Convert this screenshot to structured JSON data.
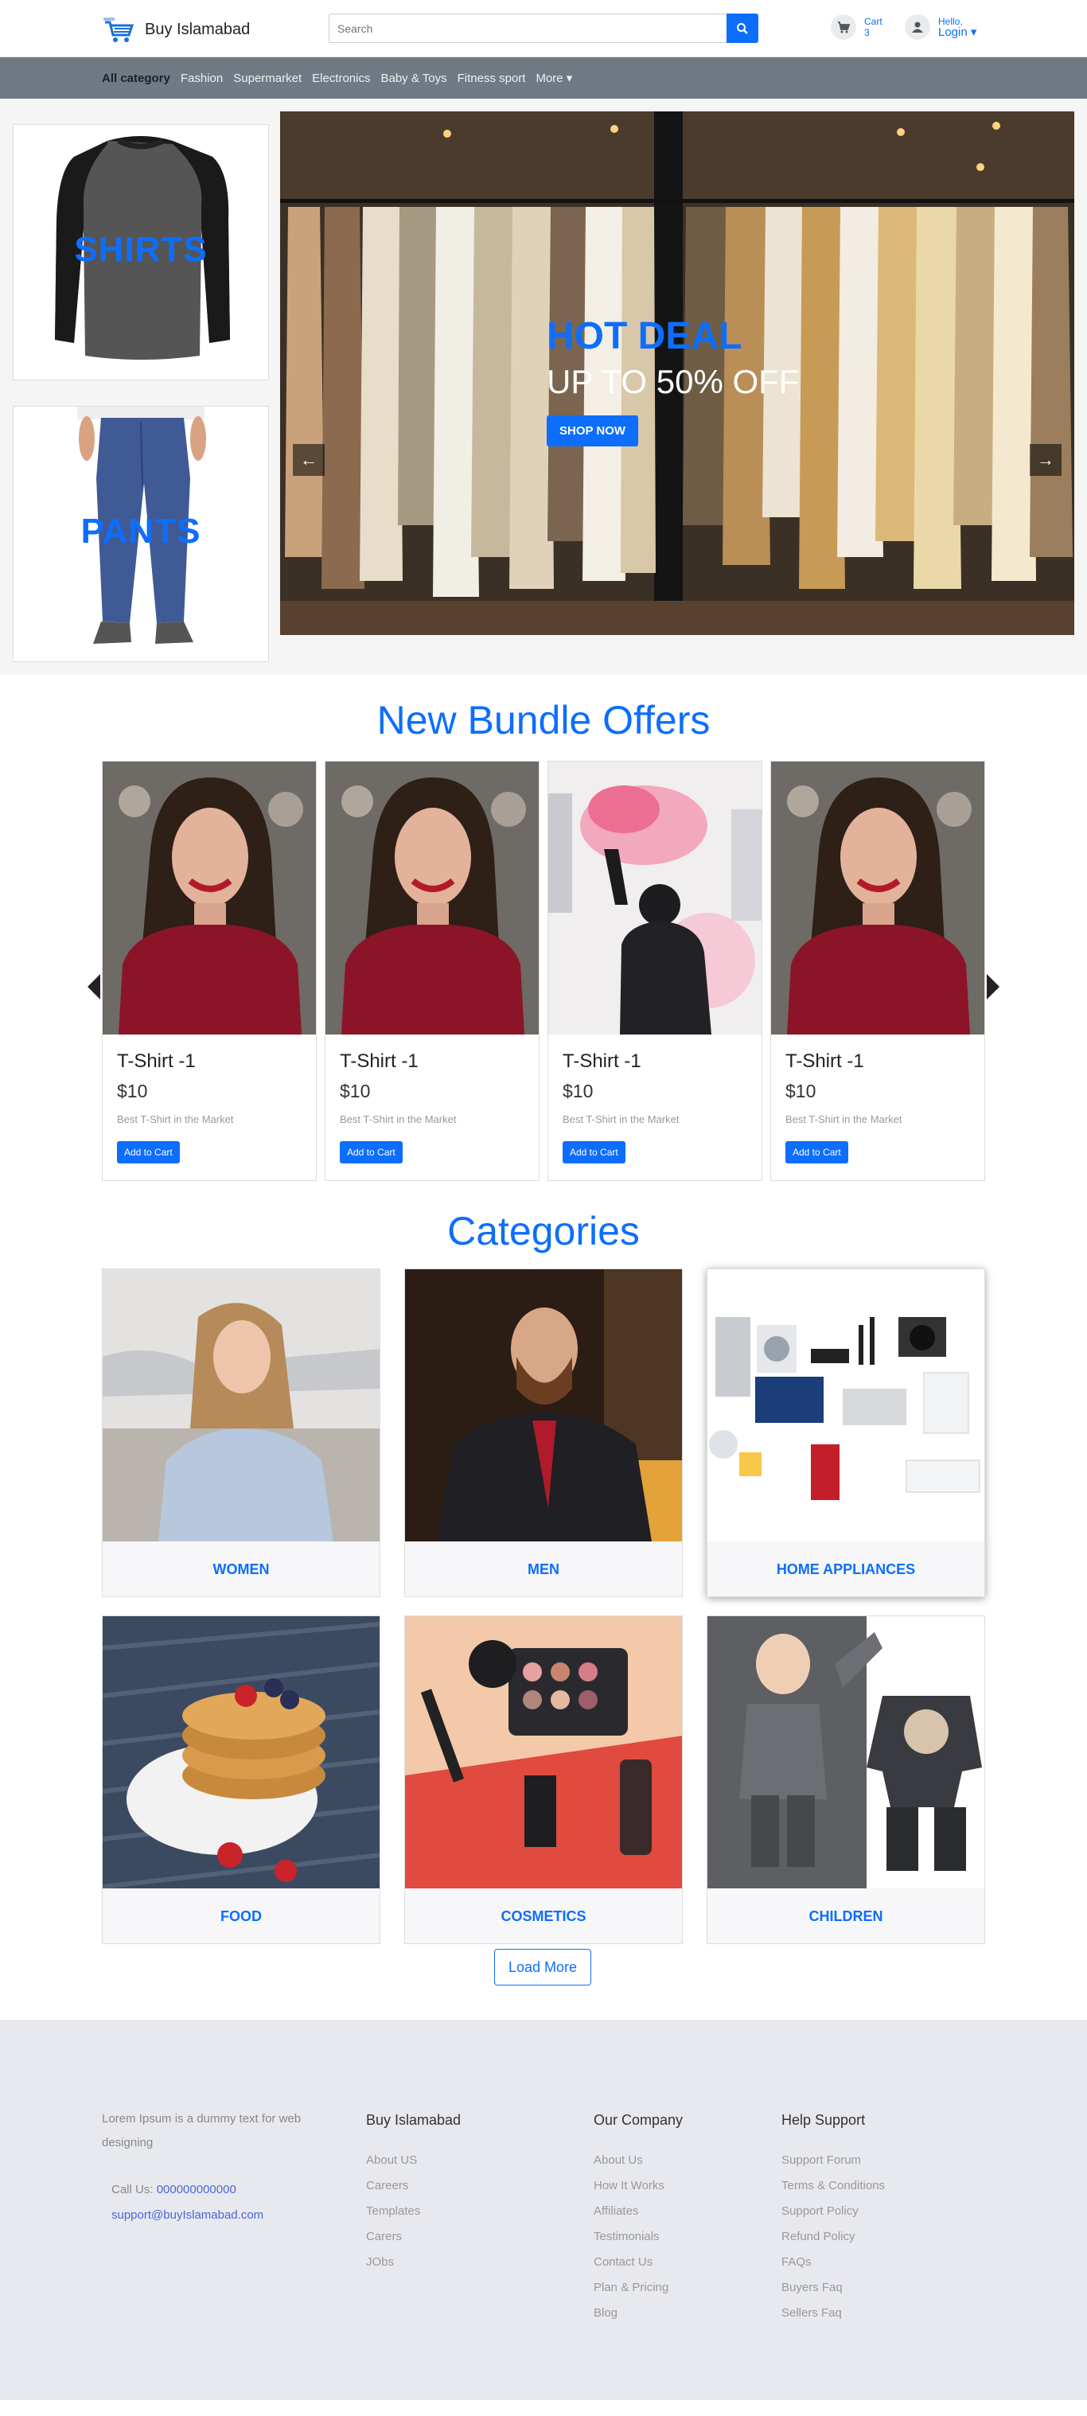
{
  "header": {
    "brand": "Buy Islamabad",
    "search_placeholder": "Search",
    "cart_label": "Cart",
    "cart_count": "3",
    "hello_label": "Hello,",
    "login_label": "Login ▾"
  },
  "nav": {
    "items": [
      "All category",
      "Fashion",
      "Supermarket",
      "Electronics",
      "Baby & Toys",
      "Fitness sport",
      "More ▾"
    ]
  },
  "hero": {
    "side_cards": [
      "SHIRTS",
      "PANTS"
    ],
    "banner_title": "HOT DEAL",
    "banner_subtitle": "UP TO 50% OFF",
    "banner_button": "SHOP NOW",
    "prev_arrow": "←",
    "next_arrow": "→"
  },
  "bundles": {
    "title": "New Bundle Offers",
    "products": [
      {
        "name": "T-Shirt -1",
        "price": "$10",
        "desc": "Best T-Shirt in the Market",
        "button": "Add to Cart"
      },
      {
        "name": "T-Shirt -1",
        "price": "$10",
        "desc": "Best T-Shirt in the Market",
        "button": "Add to Cart"
      },
      {
        "name": "T-Shirt -1",
        "price": "$10",
        "desc": "Best T-Shirt in the Market",
        "button": "Add to Cart"
      },
      {
        "name": "T-Shirt -1",
        "price": "$10",
        "desc": "Best T-Shirt in the Market",
        "button": "Add to Cart"
      }
    ]
  },
  "categories": {
    "title": "Categories",
    "items": [
      "WOMEN",
      "MEN",
      "HOME APPLIANCES",
      "FOOD",
      "COSMETICS",
      "CHILDREN"
    ],
    "load_more": "Load More"
  },
  "footer": {
    "about": "Lorem Ipsum is a dummy text for web designing",
    "call_label": "Call Us:",
    "call_value": "000000000000",
    "email": "support@buyIslamabad.com",
    "columns": [
      {
        "title": "Buy Islamabad",
        "links": [
          "About US",
          "Careers",
          "Templates",
          "Carers",
          "JObs"
        ]
      },
      {
        "title": "Our Company",
        "links": [
          "About Us",
          "How It Works",
          "Affiliates",
          "Testimonials",
          "Contact Us",
          "Plan & Pricing",
          "Blog"
        ]
      },
      {
        "title": "Help Support",
        "links": [
          "Support Forum",
          "Terms & Conditions",
          "Support Policy",
          "Refund Policy",
          "FAQs",
          "Buyers Faq",
          "Sellers Faq"
        ]
      }
    ]
  },
  "colors": {
    "primary": "#0d6efd",
    "navbar": "#707a84",
    "footer": "#e8e9ee"
  }
}
